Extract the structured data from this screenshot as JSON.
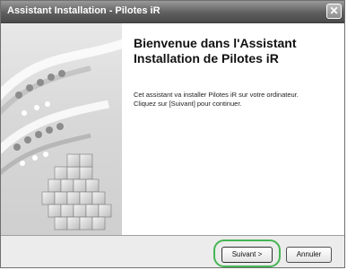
{
  "window": {
    "title": "Assistant Installation - Pilotes iR",
    "close_glyph": "✕"
  },
  "main": {
    "heading_lines": [
      "Bienvenue dans l'Assistant",
      "Installation de Pilotes iR"
    ],
    "body_lines": [
      "Cet assistant va installer Pilotes iR sur votre ordinateur.",
      "Cliquez sur [Suivant] pour continuer."
    ]
  },
  "footer": {
    "next_label": "Suivant >",
    "cancel_label": "Annuler"
  },
  "colors": {
    "highlight": "#45b552",
    "titlebar": "#5f5f5f"
  },
  "icons": {
    "close": "close-icon",
    "sidebar_art": "dna-helix-cubes-illustration"
  }
}
